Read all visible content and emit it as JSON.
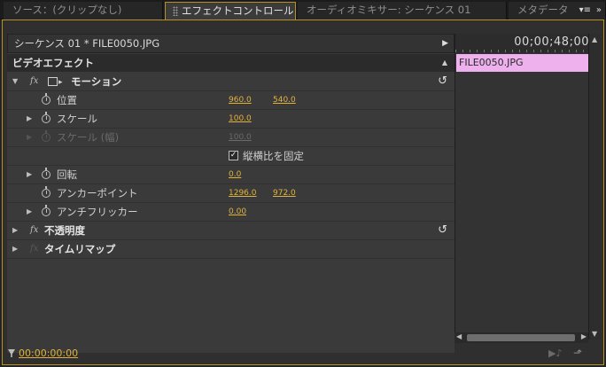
{
  "tabs": [
    {
      "label": "ソース：(クリップなし)"
    },
    {
      "label": "エフェクトコントロール",
      "close": "×"
    },
    {
      "label": "オーディオミキサー: シーケンス 01"
    },
    {
      "label": "メタデータ"
    }
  ],
  "clip_header": "シーケンス 01 * FILE0050.JPG",
  "section_title": "ビデオエフェクト",
  "timeline": {
    "timecode": "00;00;48;00",
    "clip_name": "FILE0050.JPG",
    "clip_color": "#eeb1ee"
  },
  "effects": {
    "motion": "モーション",
    "position": {
      "label": "位置",
      "x": "960.0",
      "y": "540.0"
    },
    "scale": {
      "label": "スケール",
      "value": "100.0"
    },
    "scale_width": {
      "label": "スケール (幅)",
      "value": "100.0"
    },
    "uniform": {
      "label": "縦横比を固定",
      "checked": true
    },
    "rotation": {
      "label": "回転",
      "value": "0.0"
    },
    "anchor": {
      "label": "アンカーポイント",
      "x": "1296.0",
      "y": "972.0"
    },
    "antiflicker": {
      "label": "アンチフリッカー",
      "value": "0.00"
    },
    "opacity": "不透明度",
    "time_remap": "タイムリマップ"
  },
  "footer": {
    "timecode": "00:00:00:00"
  },
  "colors": {
    "accent": "#b8902a",
    "value": "#e1b33d"
  }
}
